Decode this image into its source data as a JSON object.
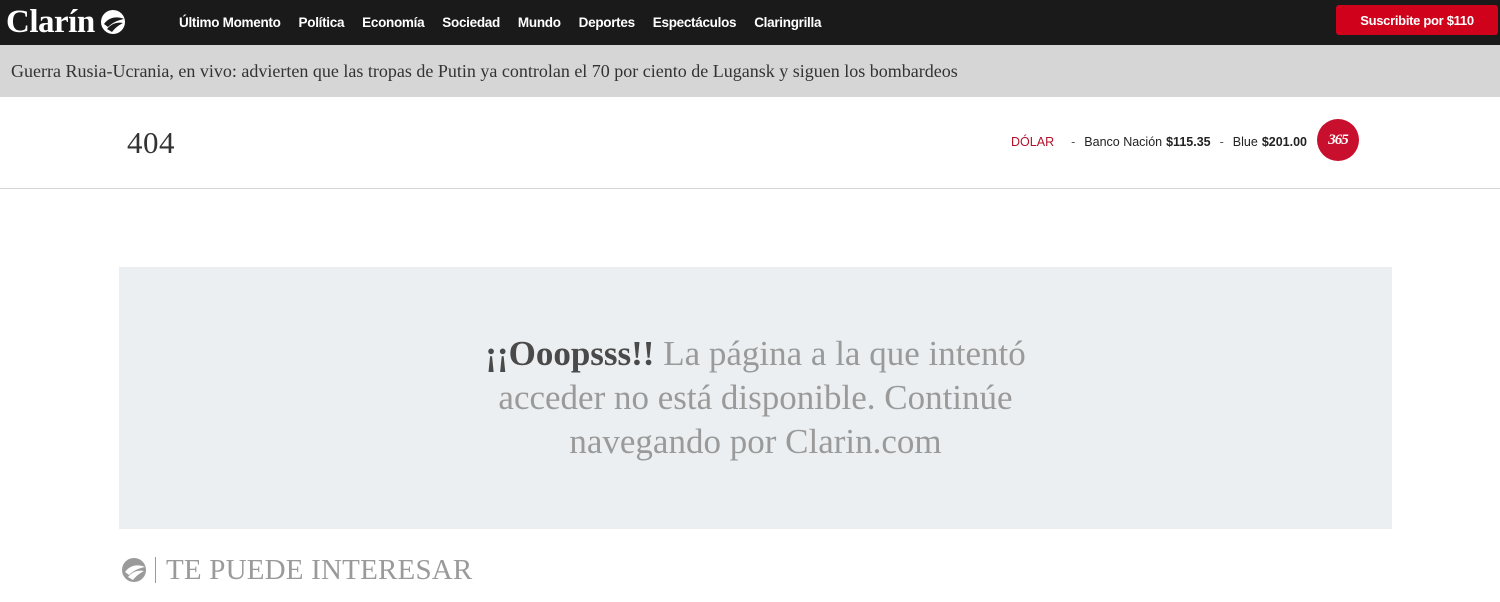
{
  "brand": {
    "name": "Clarín"
  },
  "nav": {
    "items": [
      "Último Momento",
      "Política",
      "Economía",
      "Sociedad",
      "Mundo",
      "Deportes",
      "Espectáculos",
      "Claringrilla"
    ]
  },
  "subscribe": {
    "label": "Suscribite por $110"
  },
  "breaking": {
    "headline": "Guerra Rusia-Ucrania, en vivo: advierten que las tropas de Putin ya controlan el 70 por ciento de Lugansk y siguen los bombardeos"
  },
  "header": {
    "code": "404",
    "dolar": {
      "title": "DÓLAR",
      "sep": "-",
      "bna_label": "Banco Nación",
      "bna_value": "$115.35",
      "blue_label": "Blue",
      "blue_value": "$201.00"
    },
    "badge": "365"
  },
  "error": {
    "oops": "¡¡Ooopsss!!",
    "message": " La página a la que intentó acceder no está disponible. Continúe navegando por Clarin.com"
  },
  "related": {
    "title": "TE PUEDE INTERESAR"
  },
  "colors": {
    "topbar": "#1a1a1a",
    "accent_red": "#d0021b",
    "breaking_bg": "#d6d6d6",
    "error_bg": "#eceff1"
  }
}
